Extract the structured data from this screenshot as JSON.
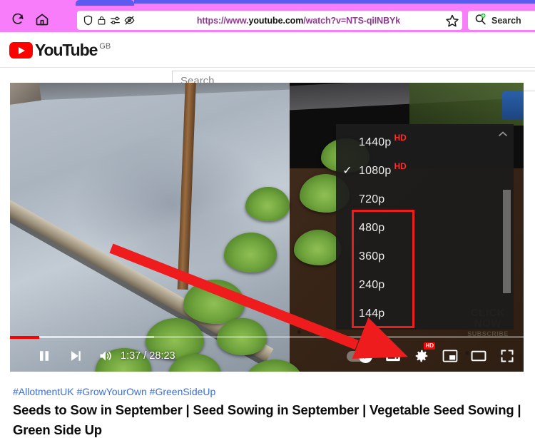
{
  "browser": {
    "toolbar_color": "#f87dfb",
    "tabstrip_color": "#5b5bf0",
    "reload_icon": "reload-icon",
    "home_icon": "home-icon",
    "shield_icon": "shield-icon",
    "lock_icon": "lock-icon",
    "permissions_icon": "permissions-icon",
    "tracking_blocked_icon": "tracking-blocked-icon",
    "bookmark_star_icon": "star-icon",
    "url_scheme": "https://www.",
    "url_host": "youtube.com",
    "url_path": "/watch?v=NTS-qiINBYk",
    "url_full": "https://www.youtube.com/watch?v=NTS-qiINBYk",
    "search_label": "Search",
    "search_icon": "search-plus-icon"
  },
  "yt_header": {
    "logo_text": "YouTube",
    "country_code": "GB",
    "play_icon": "youtube-play-icon",
    "search_placeholder": "Search",
    "search_value": ""
  },
  "player": {
    "current_time": "1:37",
    "duration": "28:23",
    "time_display": "1:37 / 28:23",
    "progress_percent": 5.7,
    "buffered_percent": 28,
    "progress_color": "#ff0000",
    "pause_icon": "pause-icon",
    "next_icon": "next-track-icon",
    "volume_icon": "volume-high-icon",
    "autoplay_icon": "autoplay-toggle-icon",
    "subtitles_icon": "subtitles-icon",
    "settings_icon": "settings-gear-icon",
    "settings_badge": "HD",
    "miniplayer_icon": "miniplayer-icon",
    "theater_icon": "theater-mode-icon",
    "fullscreen_icon": "fullscreen-icon",
    "watermark_line1": "CLICK",
    "watermark_line2": "NOW",
    "watermark_line3": "SUBSCRIBE"
  },
  "quality_menu": {
    "scroll_up_icon": "chevron-up-icon",
    "scrollbar_name": "quality-menu-scrollbar",
    "highlight_color": "#ee1c1c",
    "options": [
      {
        "label": "1440p",
        "badge": "HD",
        "selected": false
      },
      {
        "label": "1080p",
        "badge": "HD",
        "selected": true
      },
      {
        "label": "720p",
        "badge": "",
        "selected": false
      },
      {
        "label": "480p",
        "badge": "",
        "selected": false
      },
      {
        "label": "360p",
        "badge": "",
        "selected": false
      },
      {
        "label": "240p",
        "badge": "",
        "selected": false
      },
      {
        "label": "144p",
        "badge": "",
        "selected": false
      }
    ],
    "checkmark": "✓"
  },
  "annotation": {
    "arrow_color": "#ee1c1c",
    "arrow_name": "red-arrow-pointing-to-settings",
    "box_name": "red-highlight-box-low-qualities"
  },
  "video_info": {
    "hashtags": "#AllotmentUK #GrowYourOwn #GreenSideUp",
    "title": "Seeds to Sow in September | Seed Sowing in September | Vegetable Seed Sowing | Green Side Up"
  }
}
